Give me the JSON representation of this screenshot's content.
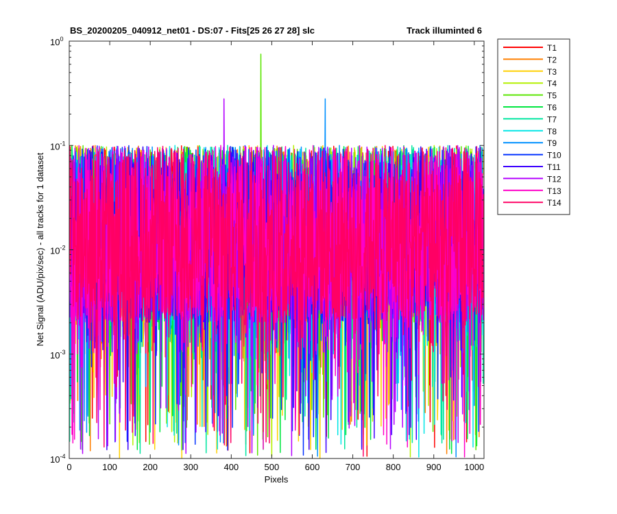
{
  "chart_data": {
    "type": "line",
    "title_left": "BS_20200205_040912_net01 - DS:07 - Fits[25  26  27  28]   slc",
    "title_right": "Track illuminted 6",
    "xlabel": "Pixels",
    "ylabel": "Net Signal (ADU/pix/sec) - all tracks for 1 dataset",
    "xlim": [
      0,
      1024
    ],
    "ylim": [
      0.0001,
      1
    ],
    "yscale": "log",
    "xticks": [
      0,
      100,
      200,
      300,
      400,
      500,
      600,
      700,
      800,
      900,
      1000
    ],
    "xtick_labels": [
      "0",
      "100",
      "200",
      "300",
      "400",
      "500",
      "600",
      "700",
      "800",
      "900",
      "1000"
    ],
    "yticks": [
      {
        "base": "10",
        "exp": "-4"
      },
      {
        "base": "10",
        "exp": "-3"
      },
      {
        "base": "10",
        "exp": "-2"
      },
      {
        "base": "10",
        "exp": "-1"
      },
      {
        "base": "10",
        "exp": "0"
      }
    ],
    "series": [
      {
        "name": "T1",
        "color": "#ff0000"
      },
      {
        "name": "T2",
        "color": "#ff7f00"
      },
      {
        "name": "T3",
        "color": "#ffd000"
      },
      {
        "name": "T4",
        "color": "#b4f000"
      },
      {
        "name": "T5",
        "color": "#5ae600"
      },
      {
        "name": "T6",
        "color": "#00e640"
      },
      {
        "name": "T7",
        "color": "#00e6a0"
      },
      {
        "name": "T8",
        "color": "#00e6e6"
      },
      {
        "name": "T9",
        "color": "#0090ff"
      },
      {
        "name": "T10",
        "color": "#0030ff"
      },
      {
        "name": "T11",
        "color": "#3c00ff"
      },
      {
        "name": "T12",
        "color": "#b400ff"
      },
      {
        "name": "T13",
        "color": "#ff00c8"
      },
      {
        "name": "T14",
        "color": "#ff0064"
      }
    ],
    "peaks": [
      {
        "x": 382,
        "y": 0.28,
        "series": "T12"
      },
      {
        "x": 473,
        "y": 0.75,
        "series": "T5"
      },
      {
        "x": 632,
        "y": 0.28,
        "series": "T9"
      }
    ],
    "typical_range": [
      0.002,
      0.1
    ],
    "points_per_series": 1024
  }
}
